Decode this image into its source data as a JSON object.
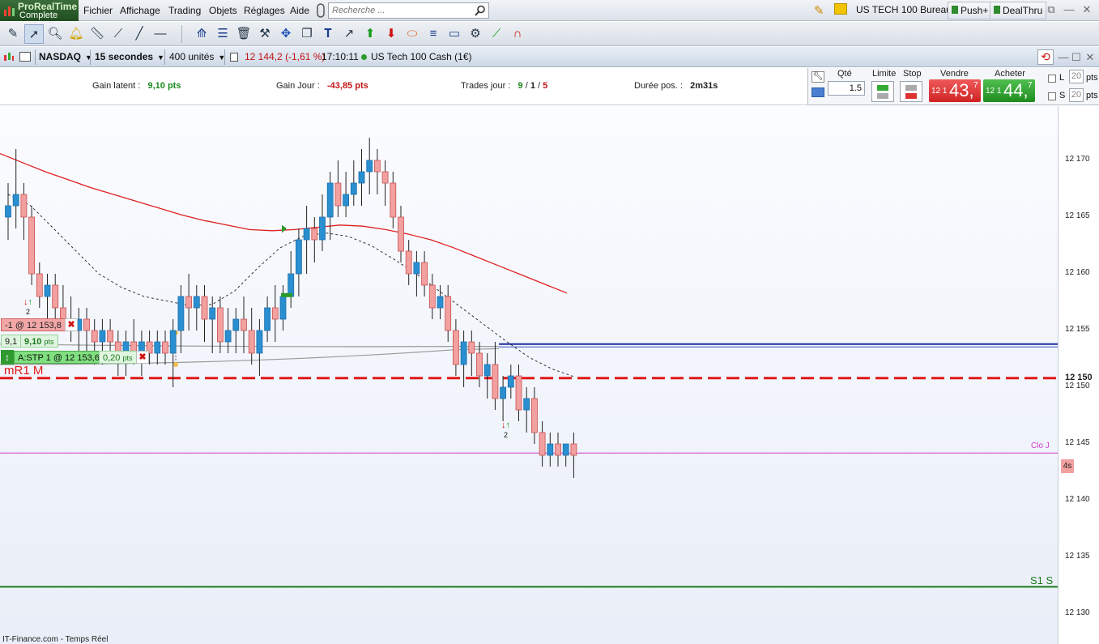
{
  "app": {
    "brand_line1": "ProRealTime",
    "brand_line2": "Complete"
  },
  "menu": [
    "Fichier",
    "Affichage",
    "Trading",
    "Objets",
    "Réglages",
    "Aide"
  ],
  "search": {
    "placeholder": "Recherche ..."
  },
  "topright": {
    "workspace": "US TECH 100 Bureau",
    "push": "Push+",
    "dealthru": "DealThru"
  },
  "chart_header": {
    "market": "NASDAQ",
    "timeframe": "15 secondes",
    "units": "400 unités",
    "price": "12 144,2",
    "change": "(-1,61 %)",
    "time": "17:10:11",
    "instrument": "US Tech 100 Cash (1€)"
  },
  "info": {
    "gain_latent_label": "Gain latent :",
    "gain_latent_value": "9,10 pts",
    "gain_jour_label": "Gain Jour :",
    "gain_jour_value": "-43,85 pts",
    "trades_label": "Trades jour :",
    "trades_a": "9",
    "trades_b": "1",
    "trades_c": "5",
    "duree_label": "Durée pos. :",
    "duree_value": "2m31s"
  },
  "order": {
    "qte_label": "Qté",
    "qte_value": "1.5",
    "limite_label": "Limite",
    "stop_label": "Stop",
    "vendre_label": "Vendre",
    "acheter_label": "Acheter",
    "sell_prefix": "12 1",
    "sell_big": "43,",
    "sell_sup": "7",
    "buy_prefix": "12 1",
    "buy_big": "44,",
    "buy_sup": "7",
    "L_label": "L",
    "S_label": "S",
    "spin_value_1": "20",
    "spin_value_2": "20",
    "pts_label": "pts"
  },
  "chart_labels": {
    "mr1": "mR1 M",
    "s1": "S1 S",
    "clo": "Clo J",
    "countdown": "4s",
    "position_tag": "-1 @ 12 153,8",
    "gain_a": "9,1",
    "gain_b": "9,10",
    "gain_pts": "pts",
    "stop_tag": "A:STP 1 @ 12 153,6",
    "stop_dist": "0,20",
    "stop_pts": "pts",
    "marker_count_1": "2",
    "marker_count_2": "2",
    "source": "IT-Finance.com - Temps Réel"
  },
  "chart_data": {
    "type": "candlestick",
    "yaxis": {
      "min": 12128,
      "max": 12174,
      "ticks": [
        12130,
        12135,
        12140,
        12145,
        12150,
        12155,
        12160,
        12165,
        12170
      ],
      "tick_labels": [
        "12 130",
        "12 135",
        "12 140",
        "12 145",
        "12 150",
        "12 155",
        "12 160",
        "12 165",
        "12 170"
      ],
      "current_label": "12 150"
    },
    "candles": [
      [
        12165,
        12168,
        12163,
        12166
      ],
      [
        12166,
        12171,
        12164,
        12167
      ],
      [
        12167,
        12168,
        12163,
        12165
      ],
      [
        12165,
        12166,
        12159,
        12160
      ],
      [
        12160,
        12161,
        12157,
        12158
      ],
      [
        12158,
        12160,
        12156,
        12159
      ],
      [
        12159,
        12160,
        12156,
        12157
      ],
      [
        12157,
        12159,
        12155,
        12156
      ],
      [
        12156,
        12158,
        12154,
        12155
      ],
      [
        12155,
        12157,
        12153,
        12156
      ],
      [
        12156,
        12157,
        12153,
        12155
      ],
      [
        12155,
        12156,
        12152,
        12154
      ],
      [
        12154,
        12156,
        12152,
        12155
      ],
      [
        12155,
        12156,
        12153,
        12154
      ],
      [
        12154,
        12155,
        12151,
        12153
      ],
      [
        12153,
        12155,
        12151,
        12154
      ],
      [
        12154,
        12156,
        12152,
        12153
      ],
      [
        12153,
        12155,
        12151,
        12154
      ],
      [
        12154,
        12155,
        12152,
        12153
      ],
      [
        12153,
        12155,
        12152,
        12154
      ],
      [
        12154,
        12155,
        12152,
        12153
      ],
      [
        12153,
        12156,
        12150,
        12155
      ],
      [
        12155,
        12159,
        12153,
        12158
      ],
      [
        12158,
        12160,
        12155,
        12157
      ],
      [
        12157,
        12159,
        12155,
        12158
      ],
      [
        12158,
        12159,
        12154,
        12156
      ],
      [
        12156,
        12158,
        12153,
        12157
      ],
      [
        12157,
        12158,
        12153,
        12154
      ],
      [
        12154,
        12157,
        12153,
        12155
      ],
      [
        12155,
        12157,
        12153,
        12156
      ],
      [
        12156,
        12158,
        12153,
        12155
      ],
      [
        12155,
        12157,
        12152,
        12153
      ],
      [
        12153,
        12156,
        12151,
        12155
      ],
      [
        12155,
        12158,
        12154,
        12157
      ],
      [
        12157,
        12159,
        12154,
        12156
      ],
      [
        12156,
        12159,
        12155,
        12158
      ],
      [
        12158,
        12162,
        12157,
        12160
      ],
      [
        12160,
        12164,
        12158,
        12163
      ],
      [
        12163,
        12166,
        12160,
        12164
      ],
      [
        12164,
        12165,
        12161,
        12163
      ],
      [
        12163,
        12167,
        12162,
        12165
      ],
      [
        12165,
        12169,
        12163,
        12168
      ],
      [
        12168,
        12170,
        12165,
        12166
      ],
      [
        12166,
        12169,
        12165,
        12167
      ],
      [
        12167,
        12170,
        12166,
        12168
      ],
      [
        12168,
        12171,
        12166,
        12169
      ],
      [
        12169,
        12172,
        12167,
        12170
      ],
      [
        12170,
        12171,
        12167,
        12169
      ],
      [
        12169,
        12170,
        12166,
        12168
      ],
      [
        12168,
        12169,
        12164,
        12165
      ],
      [
        12165,
        12166,
        12161,
        12162
      ],
      [
        12162,
        12163,
        12159,
        12160
      ],
      [
        12160,
        12162,
        12158,
        12161
      ],
      [
        12161,
        12162,
        12158,
        12159
      ],
      [
        12159,
        12160,
        12156,
        12157
      ],
      [
        12157,
        12159,
        12156,
        12158
      ],
      [
        12158,
        12159,
        12154,
        12155
      ],
      [
        12155,
        12156,
        12151,
        12152
      ],
      [
        12152,
        12155,
        12150,
        12154
      ],
      [
        12154,
        12155,
        12151,
        12153
      ],
      [
        12153,
        12154,
        12150,
        12151
      ],
      [
        12151,
        12153,
        12149,
        12152
      ],
      [
        12152,
        12154,
        12148,
        12149
      ],
      [
        12149,
        12151,
        12147,
        12150
      ],
      [
        12150,
        12152,
        12149,
        12151
      ],
      [
        12151,
        12152,
        12147,
        12148
      ],
      [
        12148,
        12150,
        12146,
        12149
      ],
      [
        12149,
        12150,
        12145,
        12146
      ],
      [
        12146,
        12147,
        12143,
        12144
      ],
      [
        12144,
        12146,
        12143,
        12145
      ],
      [
        12145,
        12146,
        12143,
        12144
      ],
      [
        12144,
        12145,
        12143,
        12145
      ],
      [
        12145,
        12146,
        12142,
        12144
      ]
    ],
    "ma_long": {
      "name": "",
      "color": "#e02020",
      "start_index": 0,
      "values": [
        12170.6,
        12169.8,
        12169,
        12168.3,
        12167.6,
        12167,
        12166.4,
        12165.8,
        12165.2,
        12164.7,
        12164.3,
        12163.9,
        12163.8,
        12163.9,
        12164.1,
        12164.3,
        12164.2,
        12163.9,
        12163.5,
        12163,
        12162.3,
        12161.5,
        12160.7,
        12159.9,
        12159.1,
        12158.3
      ]
    },
    "ma_short": {
      "name": "",
      "color": "#333333",
      "values": [
        12167,
        12166,
        12164,
        12162,
        12160,
        12158.8,
        12158,
        12157.6,
        12157.2,
        12157.3,
        12158.5,
        12160.5,
        12162.3,
        12163.3,
        12163.6,
        12163.3,
        12162.5,
        12161.3,
        12160,
        12158.5,
        12157,
        12155.5,
        12154,
        12152.6,
        12151.6,
        12150.9
      ]
    },
    "levels": [
      {
        "label": "mR1 M",
        "value": 12150.8,
        "color": "#e01818",
        "style": "dashed"
      },
      {
        "label": "S1 S",
        "value": 12132.4,
        "color": "#1d7a1d",
        "style": "solid"
      },
      {
        "label": "Clo J",
        "value": 12144.2,
        "color": "#d23ad2",
        "style": "solid"
      },
      {
        "label": "position",
        "value": 12153.8,
        "color": "#1a2fa0",
        "style": "solid"
      }
    ]
  },
  "colors": {
    "up": "#2a8fd0",
    "down": "#f2a0a0",
    "down_border": "#c85050"
  }
}
